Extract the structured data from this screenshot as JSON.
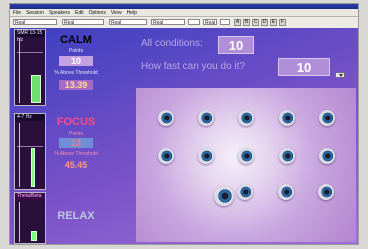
{
  "menubar": {
    "items": [
      "File",
      "Session",
      "Speakers",
      "Edit",
      "Options",
      "View",
      "Help"
    ]
  },
  "toolbar": {
    "fields": [
      "Real",
      "Real",
      "Real",
      "Real",
      "",
      "Real",
      ""
    ],
    "buttons": [
      "A",
      "B",
      "C",
      "D",
      "E",
      "F"
    ]
  },
  "left": {
    "meter1_label": "SMR 13-15 Hz",
    "meter2_label": "4-7 Hz",
    "meter3_label": "Theta/Beta",
    "calm": {
      "title": "CALM",
      "points_label": "Points",
      "points": "10",
      "pct_label": "% Above Threshold",
      "pct": "13.39"
    },
    "focus": {
      "title": "FOCUS",
      "points_label": "Points",
      "points": "13",
      "pct_label": "% Above Threshold",
      "pct": "45.45"
    },
    "relax": {
      "title": "RELAX"
    },
    "levels": {
      "meter1": 0.45,
      "meter2": 0.62,
      "meter3": 0.25
    }
  },
  "top": {
    "conditions_label": "All conditions:",
    "conditions_value": "10",
    "speed_label": "How fast can you do it?",
    "speed_value": "10"
  },
  "colors": {
    "calm": "#ffffff",
    "focus": "#ff4c86",
    "relax": "#bfc6dc",
    "calm_points": "#ffffff",
    "focus_points": "#ff7a7a",
    "pct_calm": "#ffe08a",
    "pct_focus": "#ff9a7a"
  },
  "game": {
    "icons": [
      "eye-icon"
    ]
  }
}
